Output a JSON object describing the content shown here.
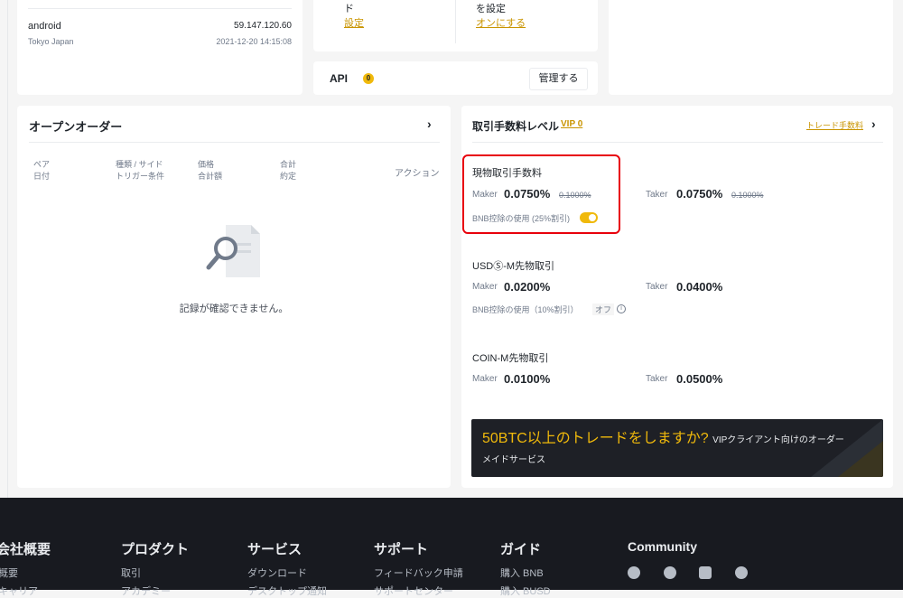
{
  "login": {
    "device": "android",
    "ip": "59.147.120.60",
    "location": "Tokyo Japan",
    "time": "2021-12-20 14:15:08"
  },
  "security": {
    "item1_text": "ド",
    "item1_link": "設定",
    "item2_text": "を設定",
    "item2_link": "オンにする"
  },
  "api": {
    "label": "API",
    "count": "0",
    "manage_button": "管理する"
  },
  "open_orders": {
    "title": "オープンオーダー",
    "columns": [
      {
        "line1": "ペア",
        "line2": "日付"
      },
      {
        "line1": "種類 / サイド",
        "line2": "トリガー条件"
      },
      {
        "line1": "価格",
        "line2": "合計額"
      },
      {
        "line1": "合計",
        "line2": "約定"
      },
      {
        "line1": "アクション",
        "line2": ""
      }
    ],
    "empty_message": "記録が確認できません。"
  },
  "fees": {
    "title": "取引手数料レベル",
    "vip_link": "VIP 0",
    "trade_fee_link": "トレード手数料",
    "spot": {
      "title": "現物取引手数料",
      "maker_label": "Maker",
      "maker_value": "0.0750%",
      "maker_old": "0.1000%",
      "taker_label": "Taker",
      "taker_value": "0.0750%",
      "taker_old": "0.1000%",
      "bnb_text": "BNB控除の使用 (25%割引)"
    },
    "usdm": {
      "title": "USDⓈ-M先物取引",
      "maker_label": "Maker",
      "maker_value": "0.0200%",
      "taker_label": "Taker",
      "taker_value": "0.0400%",
      "bnb_text": "BNB控除の使用（10%割引）",
      "bnb_status": "オフ"
    },
    "coinm": {
      "title": "COIN-M先物取引",
      "maker_label": "Maker",
      "maker_value": "0.0100%",
      "taker_label": "Taker",
      "taker_value": "0.0500%"
    },
    "banner": {
      "highlight": "50BTC以上のトレードをしますか?",
      "rest1": "VIPクライアント向けのオーダー",
      "rest2": "メイドサービス"
    }
  },
  "footer": {
    "columns": [
      {
        "title": "会社概要",
        "links": [
          "概要",
          "キャリア"
        ]
      },
      {
        "title": "プロダクト",
        "links": [
          "取引",
          "アカデミー"
        ]
      },
      {
        "title": "サービス",
        "links": [
          "ダウンロード",
          "デスクトップ通知"
        ]
      },
      {
        "title": "サポート",
        "links": [
          "フィードバック申請",
          "サポートセンター"
        ]
      },
      {
        "title": "ガイド",
        "links": [
          "購入 BNB",
          "購入 BUSD"
        ]
      },
      {
        "title": "Community",
        "links": []
      }
    ],
    "social_icons": [
      "telegram-icon",
      "facebook-icon",
      "twitter-icon",
      "reddit-icon"
    ]
  },
  "colors": {
    "accent": "#f0b90b",
    "link": "#c99400",
    "highlight_border": "#e8000b",
    "footer_bg": "#181a20"
  }
}
